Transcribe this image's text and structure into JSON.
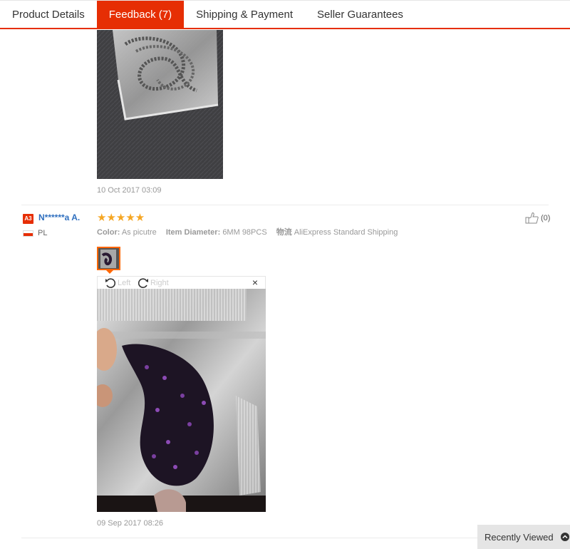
{
  "tabs": [
    {
      "label": "Product Details",
      "active": false
    },
    {
      "label": "Feedback (7)",
      "active": true
    },
    {
      "label": "Shipping & Payment",
      "active": false
    },
    {
      "label": "Seller Guarantees",
      "active": false
    }
  ],
  "review1": {
    "date": "10 Oct 2017 03:09",
    "photo_icon": "image-icon"
  },
  "review2": {
    "level_badge": "A3",
    "username": "N******a A.",
    "country": "PL",
    "stars": "★★★★★",
    "rating": 5,
    "color_label": "Color:",
    "color_value": "As picutre",
    "diameter_label": "Item Diameter:",
    "diameter_value": "6MM 98PCS",
    "logistics_label": "物流",
    "logistics_value": "AliExpress Standard Shipping",
    "helpful_count": "(0)",
    "rotate_left": "Left",
    "rotate_right": "Right",
    "close": "×",
    "date": "09 Sep 2017 08:26"
  },
  "recently_viewed": "Recently Viewed",
  "colors": {
    "accent": "#e62e04",
    "star": "#f5a623",
    "link": "#2f6fbf"
  }
}
